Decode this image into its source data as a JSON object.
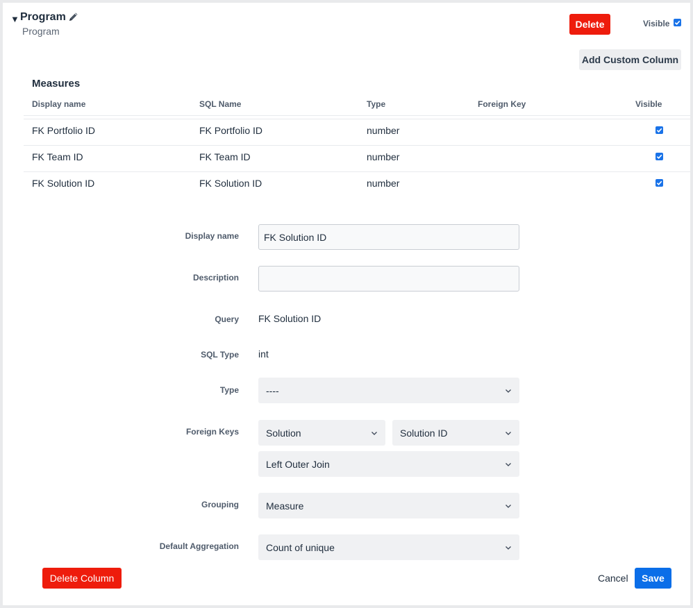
{
  "header": {
    "title": "Program",
    "subtitle": "Program",
    "delete_label": "Delete",
    "visible_label": "Visible",
    "visible_checked": true
  },
  "toolbar": {
    "add_custom_column_label": "Add Custom Column"
  },
  "measures": {
    "title": "Measures",
    "columns": {
      "display_name": "Display name",
      "sql_name": "SQL Name",
      "type": "Type",
      "foreign_key": "Foreign Key",
      "visible": "Visible"
    },
    "rows": [
      {
        "display_name": "FK Portfolio ID",
        "sql_name": "FK Portfolio ID",
        "type": "number",
        "foreign_key": "",
        "visible": true
      },
      {
        "display_name": "FK Team ID",
        "sql_name": "FK Team ID",
        "type": "number",
        "foreign_key": "",
        "visible": true
      },
      {
        "display_name": "FK Solution ID",
        "sql_name": "FK Solution ID",
        "type": "number",
        "foreign_key": "",
        "visible": true
      }
    ]
  },
  "form": {
    "display_name_label": "Display name",
    "display_name_value": "FK Solution ID",
    "description_label": "Description",
    "description_value": "",
    "query_label": "Query",
    "query_value": "FK Solution ID",
    "sql_type_label": "SQL Type",
    "sql_type_value": "int",
    "type_label": "Type",
    "type_value": "----",
    "foreign_keys_label": "Foreign Keys",
    "fk_table_value": "Solution",
    "fk_column_value": "Solution ID",
    "fk_join_value": "Left Outer Join",
    "grouping_label": "Grouping",
    "grouping_value": "Measure",
    "default_aggregation_label": "Default Aggregation",
    "default_aggregation_value": "Count of unique"
  },
  "footer": {
    "delete_column_label": "Delete Column",
    "cancel_label": "Cancel",
    "save_label": "Save"
  },
  "colors": {
    "danger": "#ee1c0c",
    "primary": "#0b6ee8",
    "checkbox": "#1a73e8"
  }
}
